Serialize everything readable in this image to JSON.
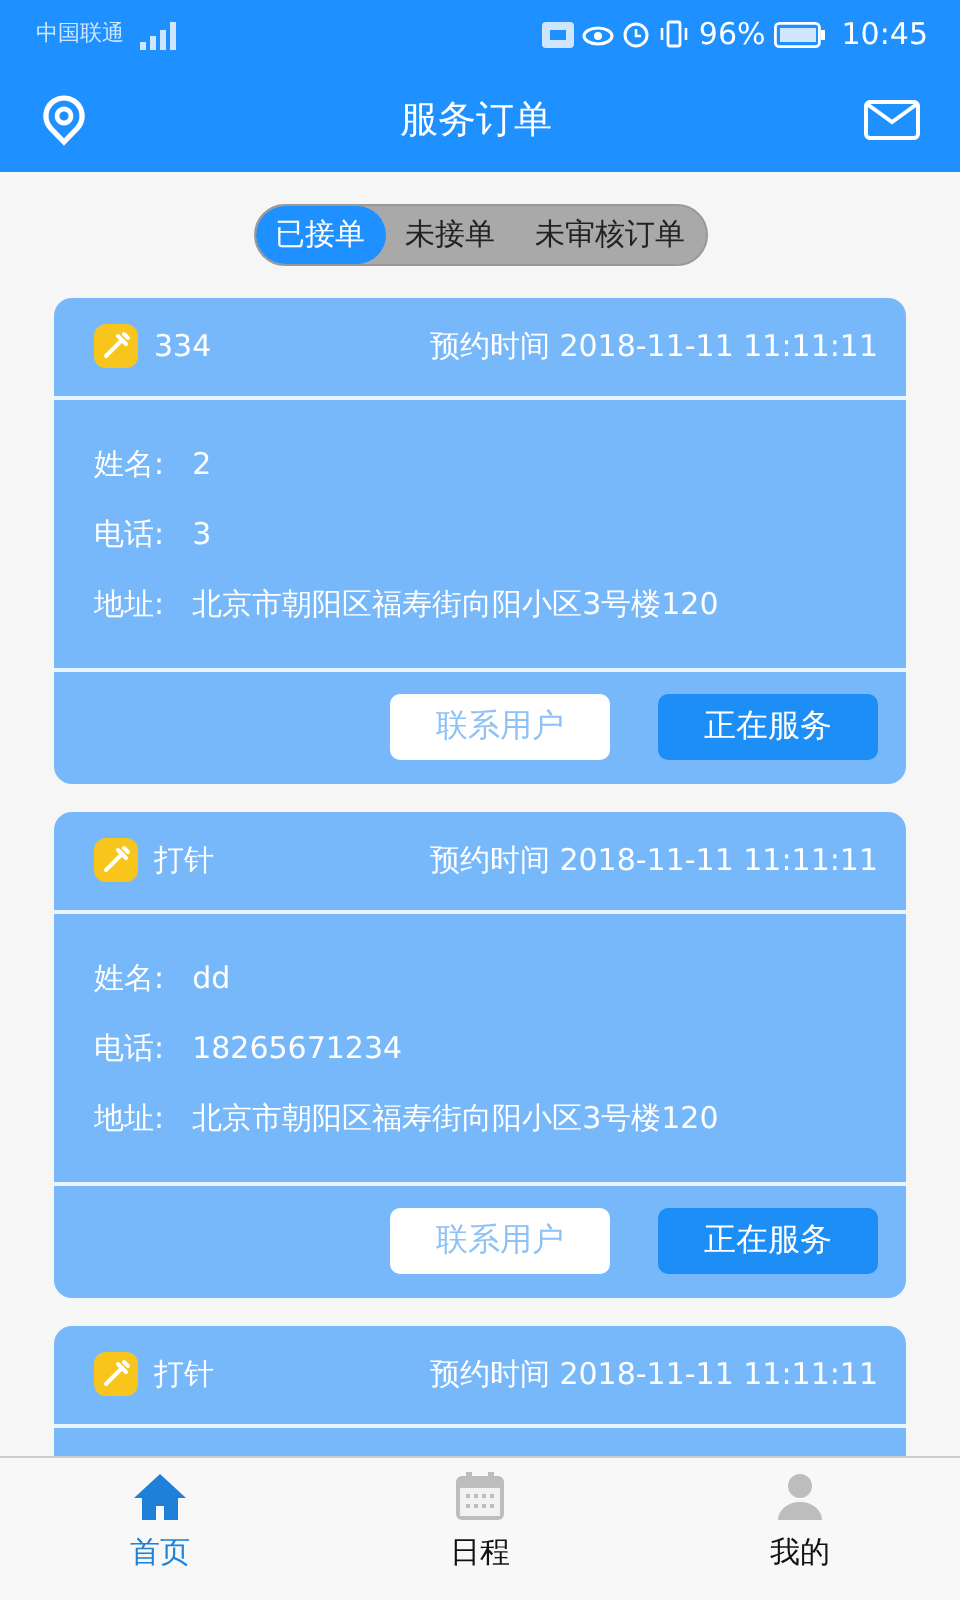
{
  "status_bar": {
    "carrier": "中国联通",
    "battery_percent": "96%",
    "time": "10:45"
  },
  "header": {
    "title": "服务订单"
  },
  "segments": [
    {
      "label": "已接单",
      "selected": true
    },
    {
      "label": "未接单",
      "selected": false
    },
    {
      "label": "未审核订单",
      "selected": false
    }
  ],
  "orders": [
    {
      "service": "334",
      "appointment": "预约时间 2018-11-11 11:11:11",
      "fields": [
        {
          "label": "姓名:",
          "value": "2"
        },
        {
          "label": "电话:",
          "value": "3"
        },
        {
          "label": "地址:",
          "value": "北京市朝阳区福寿街向阳小区3号楼120"
        }
      ],
      "buttons": [
        {
          "label": "联系用户",
          "kind": "outline"
        },
        {
          "label": "正在服务",
          "kind": "primary"
        }
      ]
    },
    {
      "service": "打针",
      "appointment": "预约时间 2018-11-11 11:11:11",
      "fields": [
        {
          "label": "姓名:",
          "value": "dd"
        },
        {
          "label": "电话:",
          "value": "18265671234"
        },
        {
          "label": "地址:",
          "value": "北京市朝阳区福寿街向阳小区3号楼120"
        }
      ],
      "buttons": [
        {
          "label": "联系用户",
          "kind": "outline"
        },
        {
          "label": "正在服务",
          "kind": "primary"
        }
      ]
    },
    {
      "service": "打针",
      "appointment": "预约时间 2018-11-11 11:11:11"
    }
  ],
  "tab_bar": [
    {
      "label": "首页",
      "kind": "home",
      "selected": true
    },
    {
      "label": "日程",
      "kind": "calendar",
      "selected": false
    },
    {
      "label": "我的",
      "kind": "person",
      "selected": false
    }
  ]
}
